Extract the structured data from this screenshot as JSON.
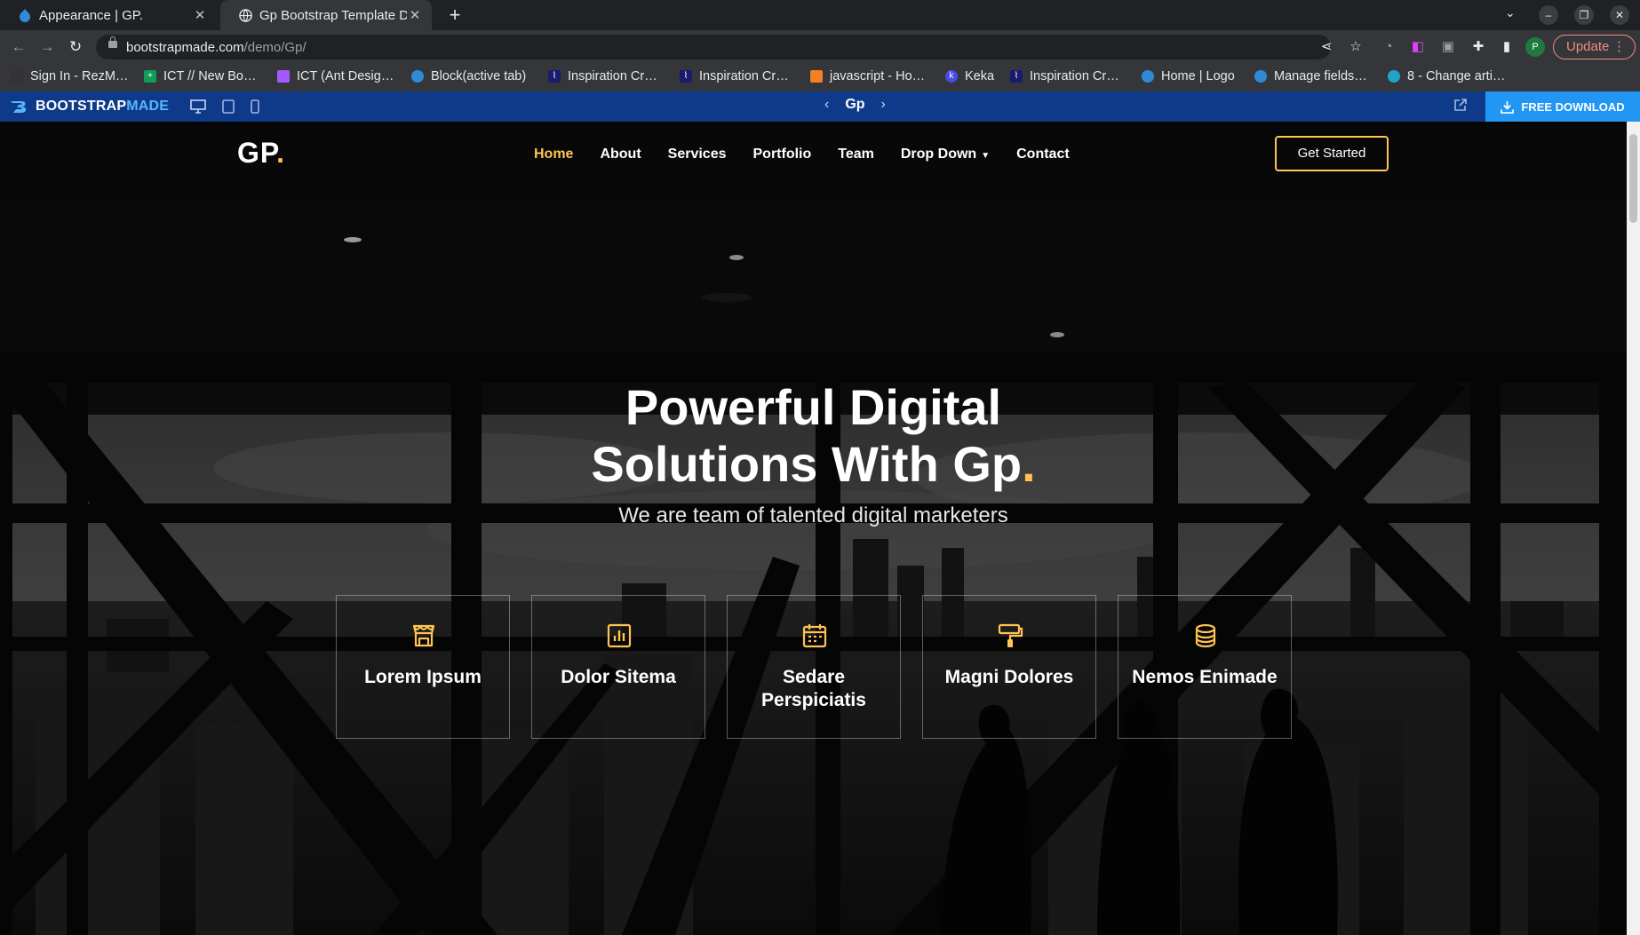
{
  "browser": {
    "tabs": [
      {
        "title": "Appearance | GP.",
        "icon": "drupal-icon",
        "active": false
      },
      {
        "title": "Gp Bootstrap Template D",
        "icon": "globe-icon",
        "active": true
      }
    ],
    "url_host": "bootstrapmade.com",
    "url_path": "/demo/Gp/",
    "update_label": "Update",
    "profile_initial": "P",
    "bookmarks": [
      {
        "label": "Sign In - RezM…",
        "icon": "rezm-icon",
        "color": "#333333"
      },
      {
        "label": "ICT // New Bo…",
        "icon": "sheets-icon",
        "color": "#0f9d58"
      },
      {
        "label": "ICT (Ant Desig…",
        "icon": "figma-icon",
        "color": "#a259ff"
      },
      {
        "label": "Block(active tab)",
        "icon": "drupal-icon",
        "color": "#2f8bd8"
      },
      {
        "label": "Inspiration Cr…",
        "icon": "bookmark-icon",
        "color": "#1a1a6e"
      },
      {
        "label": "Inspiration Cr…",
        "icon": "bookmark-icon",
        "color": "#1a1a6e"
      },
      {
        "label": "javascript - Ho…",
        "icon": "stackoverflow-icon",
        "color": "#f48024"
      },
      {
        "label": "Keka",
        "icon": "keka-icon",
        "color": "#4a4ae8"
      },
      {
        "label": "Inspiration Cr…",
        "icon": "bookmark-icon",
        "color": "#1a1a6e"
      },
      {
        "label": "Home | Logo",
        "icon": "drupal-icon",
        "color": "#2f8bd8"
      },
      {
        "label": "Manage fields…",
        "icon": "drupal-icon",
        "color": "#2f8bd8"
      },
      {
        "label": "8 - Change arti…",
        "icon": "edge-icon",
        "color": "#1fa3c9"
      }
    ]
  },
  "bootstrapmade_bar": {
    "brand_bootstrap": "BOOTSTRAP",
    "brand_made": "MADE",
    "template_name": "Gp",
    "download_label": "FREE DOWNLOAD"
  },
  "site": {
    "logo_text": "GP",
    "logo_dot": ".",
    "nav": [
      "Home",
      "About",
      "Services",
      "Portfolio",
      "Team",
      "Drop Down",
      "Contact"
    ],
    "active_nav": "Home",
    "cta_label": "Get Started",
    "hero_title_line1": "Powerful Digital",
    "hero_title_line2": "Solutions With Gp",
    "hero_title_dot": ".",
    "hero_subtitle": "We are team of talented digital marketers",
    "accent_color": "#ffc451",
    "cards": [
      {
        "title": "Lorem Ipsum",
        "icon": "store-icon"
      },
      {
        "title": "Dolor Sitema",
        "icon": "bar-chart-icon"
      },
      {
        "title": "Sedare Perspiciatis",
        "icon": "calendar-icon"
      },
      {
        "title": "Magni Dolores",
        "icon": "paint-roller-icon"
      },
      {
        "title": "Nemos Enimade",
        "icon": "database-icon"
      }
    ]
  }
}
